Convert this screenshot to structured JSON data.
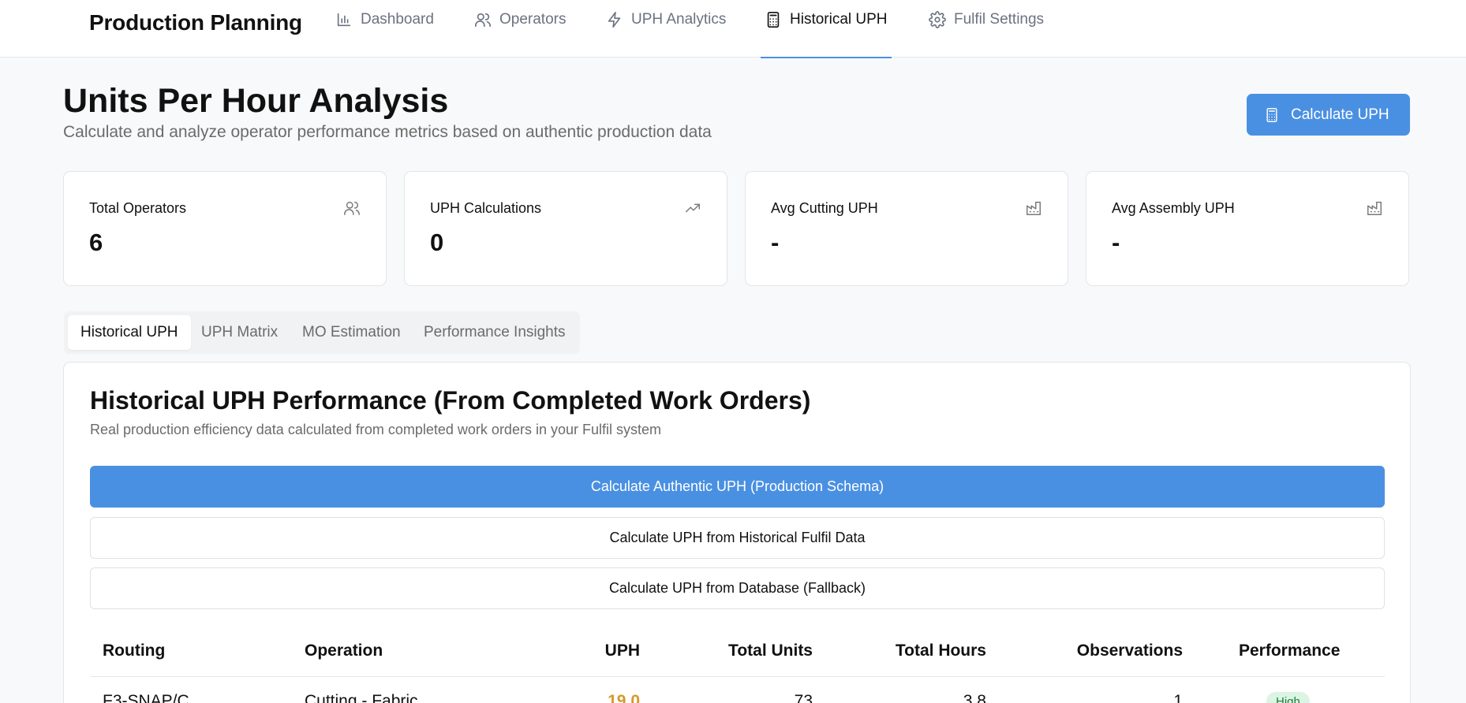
{
  "app": {
    "title": "Production Planning"
  },
  "nav": [
    {
      "label": "Dashboard",
      "icon": "bar-chart-icon"
    },
    {
      "label": "Operators",
      "icon": "users-icon"
    },
    {
      "label": "UPH Analytics",
      "icon": "lightning-icon"
    },
    {
      "label": "Historical UPH",
      "icon": "calculator-icon",
      "active": true
    },
    {
      "label": "Fulfil Settings",
      "icon": "gear-icon"
    }
  ],
  "header": {
    "title": "Units Per Hour Analysis",
    "subtitle": "Calculate and analyze operator performance metrics based on authentic production data",
    "calculate_button": "Calculate UPH"
  },
  "stats": [
    {
      "label": "Total Operators",
      "value": "6",
      "icon": "users-icon"
    },
    {
      "label": "UPH Calculations",
      "value": "0",
      "icon": "trending-up-icon"
    },
    {
      "label": "Avg Cutting UPH",
      "value": "-",
      "icon": "factory-icon"
    },
    {
      "label": "Avg Assembly UPH",
      "value": "-",
      "icon": "factory-icon"
    }
  ],
  "tabs": [
    {
      "label": "Historical UPH",
      "active": true
    },
    {
      "label": "UPH Matrix"
    },
    {
      "label": "MO Estimation"
    },
    {
      "label": "Performance Insights"
    }
  ],
  "panel": {
    "title": "Historical UPH Performance (From Completed Work Orders)",
    "description": "Real production efficiency data calculated from completed work orders in your Fulfil system",
    "buttons": [
      "Calculate Authentic UPH (Production Schema)",
      "Calculate UPH from Historical Fulfil Data",
      "Calculate UPH from Database (Fallback)"
    ]
  },
  "table": {
    "columns": [
      "Routing",
      "Operation",
      "UPH",
      "Total Units",
      "Total Hours",
      "Observations",
      "Performance"
    ],
    "rows": [
      {
        "routing": "F3-SNAP/C",
        "operation": "Cutting - Fabric",
        "uph": "19.0",
        "total_units": "73",
        "total_hours": "3.8",
        "observations": "1",
        "performance": "High"
      }
    ]
  },
  "colors": {
    "accent": "#4a90e2",
    "uph_value": "#d49a2a",
    "badge_bg": "#dcf5e3",
    "badge_text": "#1e7d3c"
  }
}
